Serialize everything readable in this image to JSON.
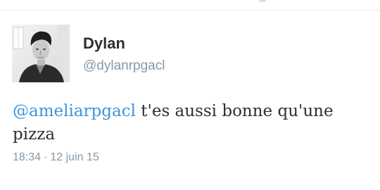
{
  "tweet": {
    "author": {
      "display_name": "Dylan",
      "screen_name": "@dylanrpgacl"
    },
    "text": {
      "mention": "@ameliarpgacl",
      "body": " t'es aussi bonne qu'une pizza"
    },
    "meta": {
      "time": "18:34",
      "separator": "·",
      "date": "12 juin 15"
    }
  },
  "colors": {
    "mention_link": "#3b94d9",
    "secondary_text": "#8899a6",
    "primary_text": "#292f33"
  }
}
